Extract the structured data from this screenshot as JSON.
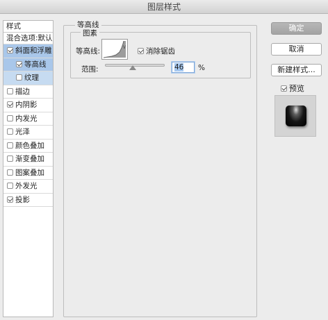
{
  "window": {
    "title": "图层样式"
  },
  "styles_panel": {
    "header": "样式",
    "blend_options": "混合选项:默认",
    "items": [
      {
        "label": "斜面和浮雕",
        "checked": true,
        "level": 0,
        "state": "selected"
      },
      {
        "label": "等高线",
        "checked": true,
        "level": 1,
        "state": "selected"
      },
      {
        "label": "纹理",
        "checked": false,
        "level": 1,
        "state": "subsel"
      },
      {
        "label": "描边",
        "checked": false,
        "level": 0,
        "state": ""
      },
      {
        "label": "内阴影",
        "checked": true,
        "level": 0,
        "state": ""
      },
      {
        "label": "内发光",
        "checked": false,
        "level": 0,
        "state": ""
      },
      {
        "label": "光泽",
        "checked": false,
        "level": 0,
        "state": ""
      },
      {
        "label": "颜色叠加",
        "checked": false,
        "level": 0,
        "state": ""
      },
      {
        "label": "渐变叠加",
        "checked": false,
        "level": 0,
        "state": ""
      },
      {
        "label": "图案叠加",
        "checked": false,
        "level": 0,
        "state": ""
      },
      {
        "label": "外发光",
        "checked": false,
        "level": 0,
        "state": ""
      },
      {
        "label": "投影",
        "checked": true,
        "level": 0,
        "state": ""
      }
    ]
  },
  "contour_panel": {
    "group_title": "等高线",
    "subgroup_title": "图素",
    "contour_label": "等高线:",
    "antialias_label": "消除锯齿",
    "antialias_checked": true,
    "range_label": "范围:",
    "range_value": "46",
    "range_unit": "%",
    "range_fraction": 0.46
  },
  "buttons": {
    "ok": "确定",
    "cancel": "取消",
    "new_style": "新建样式...",
    "preview_label": "预览",
    "preview_checked": true
  },
  "icons": {
    "contour_dropdown": "chevron-down-icon",
    "checkbox": "checkmark-icon"
  }
}
